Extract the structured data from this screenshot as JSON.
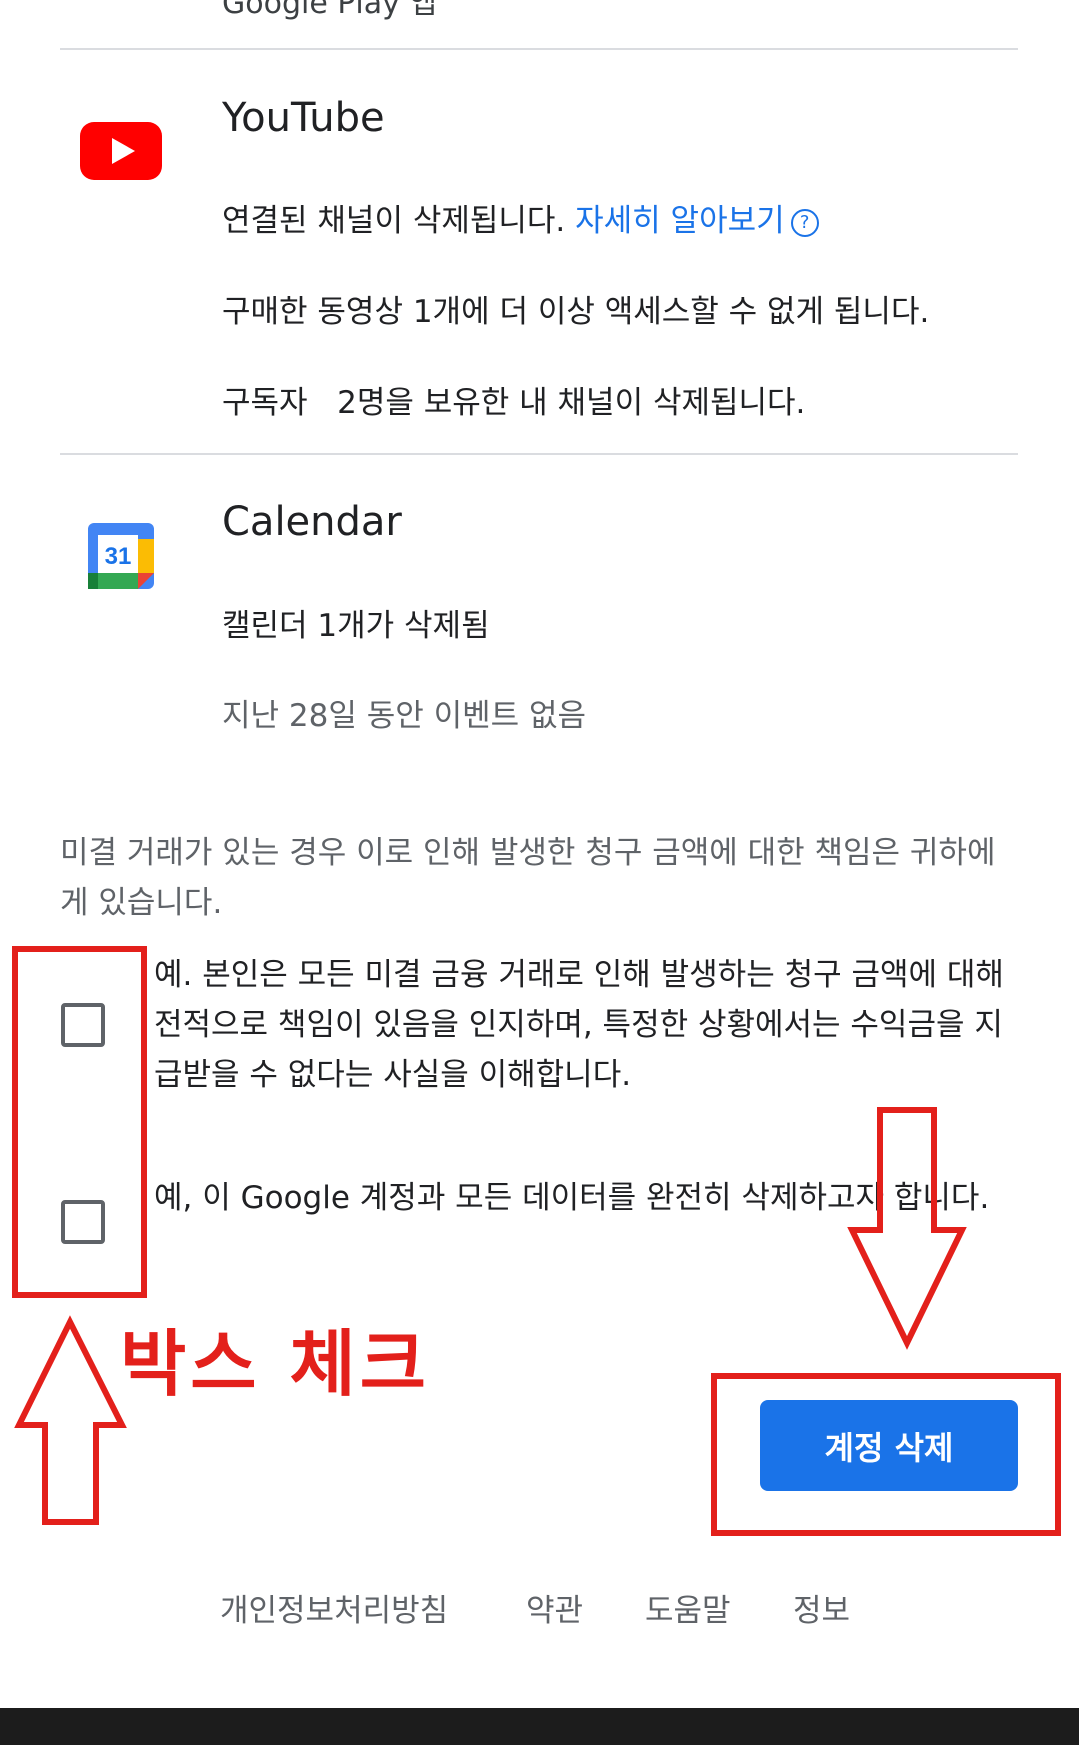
{
  "top_cut_text": "Google Play 앱",
  "services": {
    "youtube": {
      "icon": "youtube-icon",
      "title": "YouTube",
      "line1_text": "연결된 채널이 삭제됩니다.",
      "learn_more": "자세히 알아보기",
      "help_glyph": "?",
      "line2": "구매한 동영상 1개에 더 이상 액세스할 수 없게 됩니다.",
      "line3": "구독자   2명을 보유한 내 채널이 삭제됩니다."
    },
    "calendar": {
      "icon": "google-calendar-icon",
      "icon_number": "31",
      "title": "Calendar",
      "line1": "캘린더 1개가 삭제됨",
      "line2": "지난 28일 동안 이벤트 없음"
    }
  },
  "notice": "미결 거래가 있는 경우 이로 인해 발생한 청구 금액에 대한 책임은 귀하에게 있습니다.",
  "checkboxes": [
    {
      "label": "예. 본인은 모든 미결 금융 거래로 인해 발생하는 청구 금액에 대해 전적으로 책임이 있음을 인지하며, 특정한 상황에서는 수익금을 지급받을 수 없다는 사실을 이해합니다.",
      "checked": false
    },
    {
      "label": "예, 이 Google 계정과 모든 데이터를 완전히 삭제하고자 합니다.",
      "checked": false
    }
  ],
  "delete_button": "계정 삭제",
  "footer": {
    "privacy": "개인정보처리방침",
    "terms": "약관",
    "help": "도움말",
    "about": "정보"
  },
  "annotation": {
    "text": "박스  체크",
    "color": "#e3201b"
  },
  "colors": {
    "accent": "#1a73e8",
    "youtube_red": "#ff0000",
    "divider": "#dadce0"
  }
}
